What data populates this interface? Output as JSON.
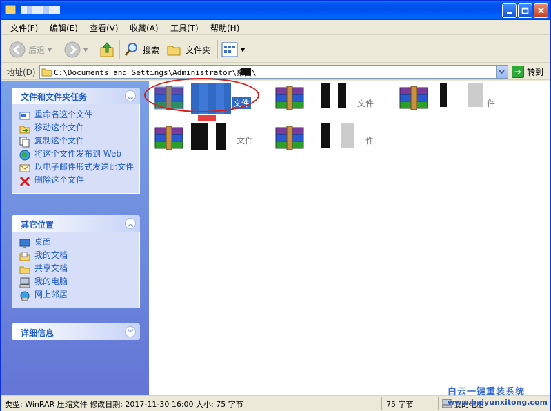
{
  "menu": [
    "文件(F)",
    "编辑(E)",
    "查看(V)",
    "收藏(A)",
    "工具(T)",
    "帮助(H)"
  ],
  "toolbar": {
    "back": "后退",
    "search": "搜索",
    "folders": "文件夹"
  },
  "address": {
    "label": "地址(D)",
    "path": "C:\\Documents and Settings\\Administrator\\桌面\\",
    "go": "转到"
  },
  "tasks": {
    "title": "文件和文件夹任务",
    "items": [
      "重命名这个文件",
      "移动这个文件",
      "复制这个文件",
      "将这个文件发布到 Web",
      "以电子邮件形式发送此文件",
      "删除这个文件"
    ]
  },
  "places": {
    "title": "其它位置",
    "items": [
      "桌面",
      "我的文档",
      "共享文档",
      "我的电脑",
      "网上邻居"
    ]
  },
  "details": {
    "title": "详细信息"
  },
  "files": [
    {
      "suffix": "文件",
      "selected": true
    },
    {
      "suffix": "文件",
      "selected": false
    },
    {
      "suffix": "件",
      "selected": false
    },
    {
      "suffix": "文件",
      "selected": false
    },
    {
      "suffix": "件",
      "selected": false
    }
  ],
  "status": {
    "info": "类型: WinRAR 压缩文件 修改日期: 2017-11-30 16:00 大小: 75 字节",
    "size": "75 字节",
    "zone": "我的电脑"
  },
  "watermark": {
    "name": "白云一键重装系统",
    "url": "www.baiyunxitong.com"
  },
  "colors": {
    "title_blue": "#0053ee",
    "task_link": "#215dc6",
    "pane_blue": "#7ba2e7",
    "selection": "#316ac5",
    "annotation_red": "#d8201a"
  }
}
